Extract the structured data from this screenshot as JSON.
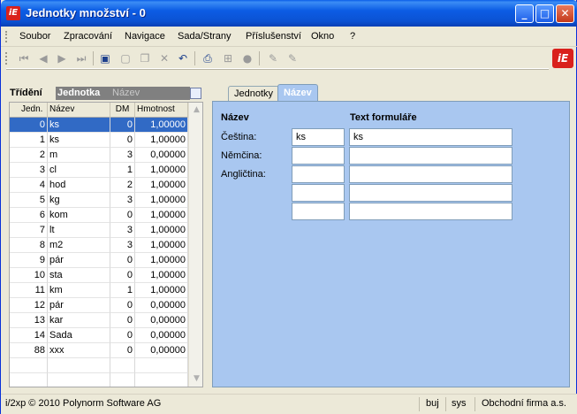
{
  "window": {
    "title": "Jednotky množství - 0",
    "logo_text": "iE",
    "min_glyph": "_",
    "max_glyph": "□",
    "close_glyph": "✕"
  },
  "menu": [
    "Soubor",
    "Zpracování",
    "Navigace",
    "Sada/Strany",
    "Příslušenství",
    "Okno",
    "?"
  ],
  "toolbar_icons": [
    "first-icon",
    "prev-icon",
    "next-icon",
    "last-icon",
    "save-icon",
    "new-icon",
    "copy-icon",
    "delete-icon",
    "undo-icon",
    "print-icon",
    "tree-icon",
    "filter-icon",
    "edit-icon",
    "edit-off-icon"
  ],
  "sort": {
    "label": "Třídění",
    "option_active": "Jednotka",
    "option_inactive": "Název"
  },
  "grid": {
    "columns": [
      "Jedn.",
      "Název",
      "DM",
      "Hmotnost"
    ],
    "rows": [
      {
        "jedn": "0",
        "nazev": "ks",
        "dm": "0",
        "hm": "1,00000",
        "selected": true
      },
      {
        "jedn": "1",
        "nazev": "ks",
        "dm": "0",
        "hm": "1,00000"
      },
      {
        "jedn": "2",
        "nazev": "m",
        "dm": "3",
        "hm": "0,00000"
      },
      {
        "jedn": "3",
        "nazev": "cl",
        "dm": "1",
        "hm": "1,00000"
      },
      {
        "jedn": "4",
        "nazev": "hod",
        "dm": "2",
        "hm": "1,00000"
      },
      {
        "jedn": "5",
        "nazev": "kg",
        "dm": "3",
        "hm": "1,00000"
      },
      {
        "jedn": "6",
        "nazev": "kom",
        "dm": "0",
        "hm": "1,00000"
      },
      {
        "jedn": "7",
        "nazev": "lt",
        "dm": "3",
        "hm": "1,00000"
      },
      {
        "jedn": "8",
        "nazev": "m2",
        "dm": "3",
        "hm": "1,00000"
      },
      {
        "jedn": "9",
        "nazev": "pár",
        "dm": "0",
        "hm": "1,00000"
      },
      {
        "jedn": "10",
        "nazev": "sta",
        "dm": "0",
        "hm": "1,00000"
      },
      {
        "jedn": "11",
        "nazev": "km",
        "dm": "1",
        "hm": "1,00000"
      },
      {
        "jedn": "12",
        "nazev": "pár",
        "dm": "0",
        "hm": "0,00000"
      },
      {
        "jedn": "13",
        "nazev": "kar",
        "dm": "0",
        "hm": "0,00000"
      },
      {
        "jedn": "14",
        "nazev": "Sada",
        "dm": "0",
        "hm": "0,00000"
      },
      {
        "jedn": "88",
        "nazev": "xxx",
        "dm": "0",
        "hm": "0,00000"
      }
    ]
  },
  "tabs": [
    "Jednotky",
    "Název"
  ],
  "form": {
    "col1_header": "Název",
    "col2_header": "Text formuláře",
    "rows": [
      {
        "label": "Čeština:",
        "name": "ks",
        "text": "ks"
      },
      {
        "label": "Němčina:",
        "name": "",
        "text": ""
      },
      {
        "label": "Angličtina:",
        "name": "",
        "text": ""
      },
      {
        "label": "",
        "name": "",
        "text": ""
      },
      {
        "label": "",
        "name": "",
        "text": ""
      }
    ]
  },
  "status": {
    "copyright": "i/2xp © 2010 Polynorm Software AG",
    "user": "buj",
    "db": "sys",
    "company": "Obchodní firma a.s."
  },
  "colors": {
    "title_blue": "#0b52d3",
    "selection": "#316ac5",
    "panel": "#a9c7f0",
    "logo_red": "#d9211c"
  }
}
